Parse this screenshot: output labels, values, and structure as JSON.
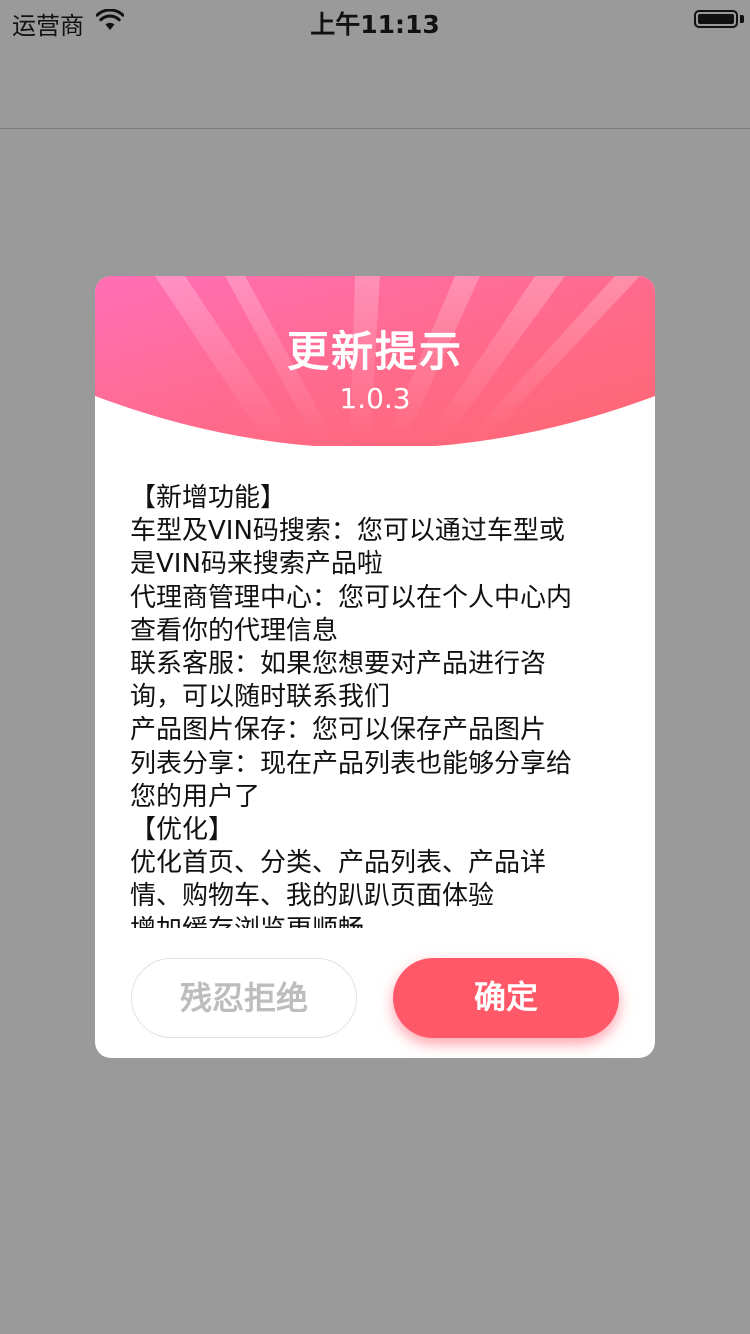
{
  "status_bar": {
    "carrier": "运营商",
    "time": "上午11:13"
  },
  "dialog": {
    "title": "更新提示",
    "version": "1.0.3",
    "content_lines": [
      "【新增功能】",
      "车型及VIN码搜索：您可以通过车型或",
      "是VIN码来搜索产品啦",
      "代理商管理中心：您可以在个人中心内",
      "查看你的代理信息",
      "联系客服：如果您想要对产品进行咨",
      "询，可以随时联系我们",
      "产品图片保存：您可以保存产品图片",
      "列表分享：现在产品列表也能够分享给",
      "您的用户了",
      "【优化】",
      "优化首页、分类、产品列表、产品详",
      "情、购物车、我的趴趴页面体验",
      "增加缓存浏览更顺畅"
    ],
    "cancel_label": "残忍拒绝",
    "confirm_label": "确定"
  },
  "colors": {
    "overlay": "#9a9a9a",
    "header_gradient_start": "#ff6fb0",
    "header_gradient_end": "#ff6670",
    "confirm_button": "#ff5869"
  }
}
